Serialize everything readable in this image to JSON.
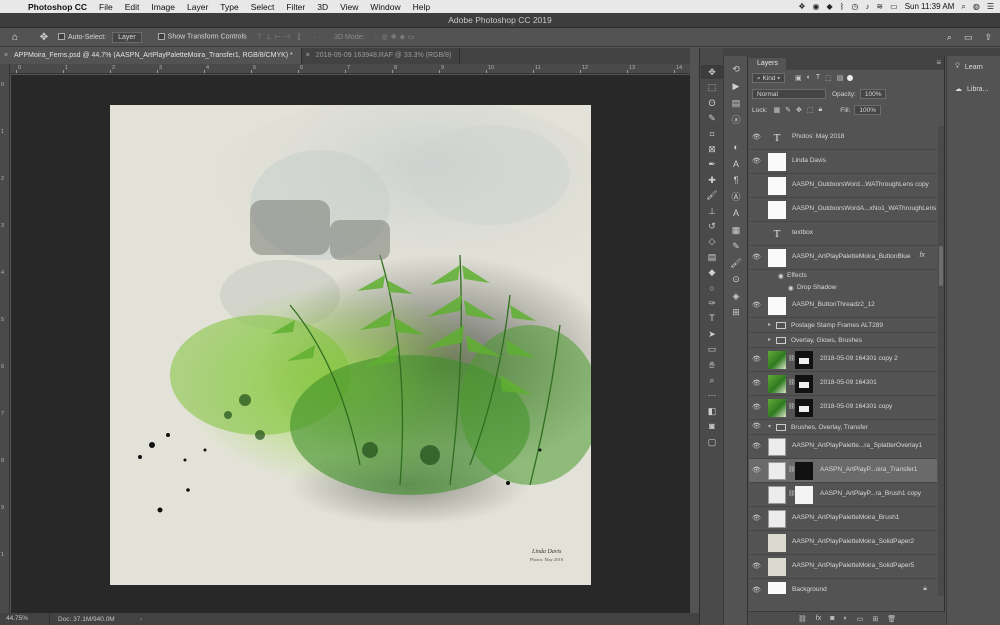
{
  "menubar": {
    "app_name": "Photoshop CC",
    "items": [
      "File",
      "Edit",
      "Image",
      "Layer",
      "Type",
      "Select",
      "Filter",
      "3D",
      "View",
      "Window",
      "Help"
    ],
    "clock": "Sun 11:39 AM"
  },
  "window": {
    "title": "Adobe Photoshop CC 2019"
  },
  "options": {
    "auto_select_label": "Auto-Select:",
    "auto_select_value": "Layer",
    "transform_label": "Show Transform Controls",
    "mode_3d_label": "3D Mode:"
  },
  "tabs": [
    {
      "label": "APPMoira_Ferns.psd @ 44.7% (AASPN_ArtPlayPaletteMoira_Transfer1, RGB/8/CMYK) *",
      "active": true
    },
    {
      "label": "2018-05-09 163948.RAF @ 33.3% (RGB/8)",
      "active": false
    }
  ],
  "ruler": {
    "h": [
      "0",
      "1",
      "2",
      "3",
      "4",
      "5",
      "6",
      "7",
      "8",
      "9",
      "10",
      "11",
      "12",
      "13",
      "14"
    ],
    "v": [
      "0",
      "1",
      "2",
      "3",
      "4",
      "5",
      "6",
      "7",
      "8",
      "9",
      "1"
    ]
  },
  "status": {
    "zoom": "44.75%",
    "doc": "Doc: 37.1M/940.0M"
  },
  "tools": [
    "move",
    "marquee",
    "lasso",
    "quick-select",
    "crop",
    "frame",
    "eyedropper",
    "healing",
    "brush",
    "stamp",
    "history-brush",
    "eraser",
    "gradient",
    "blur",
    "dodge",
    "pen",
    "type",
    "path-select",
    "rectangle",
    "hand",
    "zoom",
    "more",
    "colors",
    "quickmask",
    "screenmode"
  ],
  "toolcol_icons": [
    "history",
    "actions",
    "properties",
    "paths",
    "adjust",
    "character",
    "paragraph",
    "glyphs",
    "type-style",
    "swatch",
    "brush-settings",
    "brushes",
    "clone-source",
    "3d",
    "navigator"
  ],
  "layers_panel": {
    "tab": "Layers",
    "kind_label": "Kind",
    "blend_mode": "Normal",
    "opacity_label": "Opacity:",
    "opacity": "100%",
    "lock_label": "Lock:",
    "fill_label": "Fill:",
    "fill": "100%",
    "layers": [
      {
        "name": "Photos: May 2018",
        "type": "text",
        "visible": true
      },
      {
        "name": "Linda Davis",
        "type": "white",
        "visible": true
      },
      {
        "name": "AASPN_OutdoorsWord...WAThroughLens copy",
        "type": "white",
        "visible": false
      },
      {
        "name": "AASPN_OutdoorsWordA...xNo1_WAThroughLens",
        "type": "white",
        "visible": false
      },
      {
        "name": "textbox",
        "type": "text",
        "visible": false
      },
      {
        "name": "AASPN_ArtPlayPaletteMoira_ButtonBlue",
        "type": "white",
        "visible": true,
        "fx": "fx"
      },
      {
        "name": "Effects",
        "type": "effect"
      },
      {
        "name": "Drop Shadow",
        "type": "effect2"
      },
      {
        "name": "AASPN_ButtonThreadz2_12",
        "type": "white",
        "visible": true
      },
      {
        "name": "Postage Stamp Frames ALT289",
        "type": "group",
        "visible": false
      },
      {
        "name": "Overlay, Glows, Brushes",
        "type": "group",
        "visible": false
      },
      {
        "name": "2018-05-09 164301 copy 2",
        "type": "photo",
        "visible": true
      },
      {
        "name": "2018-05-09 164301",
        "type": "photo",
        "visible": true
      },
      {
        "name": "2018-05-09 164301 copy",
        "type": "photo",
        "visible": true
      },
      {
        "name": "Brushes, Overlay, Transfer",
        "type": "groupopen",
        "visible": true
      },
      {
        "name": "AASPN_ArtPlayPalette...ra_SplatterOverlay1",
        "type": "tex",
        "visible": true
      },
      {
        "name": "AASPN_ArtPlayP...oira_Transfer1",
        "type": "texmask",
        "visible": true,
        "selected": true
      },
      {
        "name": "AASPN_ArtPlayP...ra_Brush1 copy",
        "type": "texmaskw",
        "visible": false
      },
      {
        "name": "AASPN_ArtPlayPaletteMoira_Brush1",
        "type": "tex",
        "visible": true
      },
      {
        "name": "AASPN_ArtPlayPaletteMoira_SolidPaper2",
        "type": "paper",
        "visible": false
      },
      {
        "name": "AASPN_ArtPlayPaletteMoira_SolidPaper5",
        "type": "paper",
        "visible": true
      },
      {
        "name": "Background",
        "type": "white",
        "visible": true,
        "locked": true
      }
    ]
  },
  "right_panel": {
    "items": [
      "Learn",
      "Libra..."
    ]
  },
  "artwork": {
    "signature_line1": "Linda Davis",
    "signature_line2": "Photos: May 2018"
  }
}
